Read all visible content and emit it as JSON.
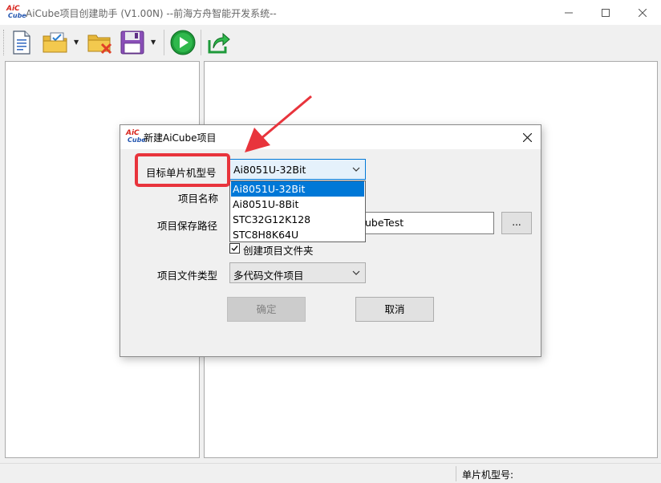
{
  "window": {
    "logo_line1": "AiC",
    "logo_line2": "Cube",
    "title": "AiCube项目创建助手 (V1.00N) --前海方舟智能开发系统--"
  },
  "toolbar": {
    "buttons": [
      "new-project",
      "open-project",
      "close-project",
      "save-project",
      "run",
      "export"
    ]
  },
  "statusbar": {
    "mcu_label": "单片机型号:"
  },
  "dialog": {
    "title": "新建AiCube项目",
    "target_mcu_label": "目标单片机型号",
    "target_mcu_value": "Ai8051U-32Bit",
    "project_name_label": "项目名称",
    "save_path_label": "项目保存路径",
    "save_path_value": "ubeTest",
    "browse_label": "...",
    "create_folder_label": "创建项目文件夹",
    "create_folder_checked": true,
    "file_type_label": "项目文件类型",
    "file_type_value": "多代码文件项目",
    "ok_label": "确定",
    "cancel_label": "取消"
  },
  "dropdown": {
    "options": [
      "Ai8051U-32Bit",
      "Ai8051U-8Bit",
      "STC32G12K128",
      "STC8H8K64U"
    ],
    "selected_index": 0
  },
  "colors": {
    "accent": "#0078d7",
    "annotation": "#e8343c"
  }
}
